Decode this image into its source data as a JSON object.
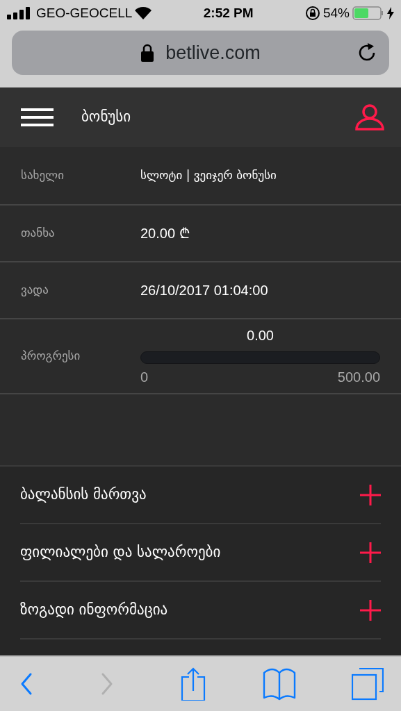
{
  "status_bar": {
    "carrier": "GEO-GEOCELL",
    "time": "2:52 PM",
    "battery": "54%"
  },
  "address_bar": {
    "url": "betlive.com"
  },
  "header": {
    "title": "ბონუსი"
  },
  "details": [
    {
      "kind": "text",
      "label": "სახელი",
      "value": "სლოტი | ვეიჯერ ბონუსი"
    },
    {
      "kind": "text",
      "label": "თანხა",
      "value": "20.00 ₾"
    },
    {
      "kind": "text",
      "label": "ვადა",
      "value": "26/10/2017 01:04:00"
    },
    {
      "kind": "progress",
      "label": "პროგრესი",
      "reading": "0.00",
      "level": 0,
      "min": "0",
      "max": "500.00"
    }
  ],
  "menu": [
    {
      "label": "ბალანსის მართვა",
      "expanded": false
    },
    {
      "label": "ფილიალები და სალაროები",
      "expanded": false
    },
    {
      "label": "ზოგადი ინფორმაცია",
      "expanded": false
    }
  ],
  "toolbar": [
    {
      "kind": "back",
      "disabled": false
    },
    {
      "kind": "forward",
      "disabled": true
    },
    {
      "kind": "share",
      "disabled": false
    },
    {
      "kind": "bookmarks",
      "disabled": false
    },
    {
      "kind": "tabs",
      "disabled": false
    }
  ]
}
